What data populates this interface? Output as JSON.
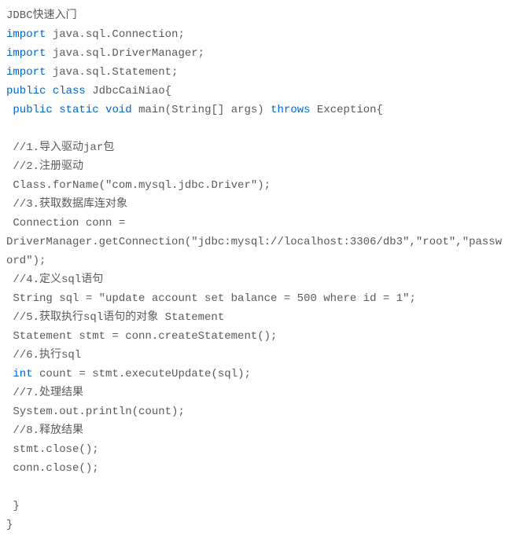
{
  "code": {
    "line1": "JDBC快速入门",
    "line2_kw1": "import",
    "line2_rest": " java.sql.Connection;",
    "line3_kw1": "import",
    "line3_rest": " java.sql.DriverManager;",
    "line4_kw1": "import",
    "line4_rest": " java.sql.Statement;",
    "line5_kw1": "public",
    "line5_kw2": "class",
    "line5_rest": " JdbcCaiNiao{",
    "line6_kw1": "public",
    "line6_kw2": "static",
    "line6_kw3": "void",
    "line6_mid": " main(String[] args) ",
    "line6_kw4": "throws",
    "line6_rest": " Exception{",
    "line7": "",
    "line8": " //1.导入驱动jar包",
    "line9": " //2.注册驱动",
    "line10": " Class.forName(\"com.mysql.jdbc.Driver\");",
    "line11": " //3.获取数据库连对象",
    "line12": " Connection conn = DriverManager.getConnection(\"jdbc:mysql://localhost:3306/db3\",\"root\",\"password\");",
    "line13": " //4.定义sql语句",
    "line14": " String sql = \"update account set balance = 500 where id = 1\";",
    "line15": " //5.获取执行sql语句的对象 Statement",
    "line16": " Statement stmt = conn.createStatement();",
    "line17": " //6.执行sql",
    "line18_kw1": "int",
    "line18_rest": " count = stmt.executeUpdate(sql);",
    "line19": " //7.处理结果",
    "line20": " System.out.println(count);",
    "line21": " //8.释放结果",
    "line22": " stmt.close();",
    "line23": " conn.close();",
    "line24": "",
    "line25": " }",
    "line26": "}"
  }
}
